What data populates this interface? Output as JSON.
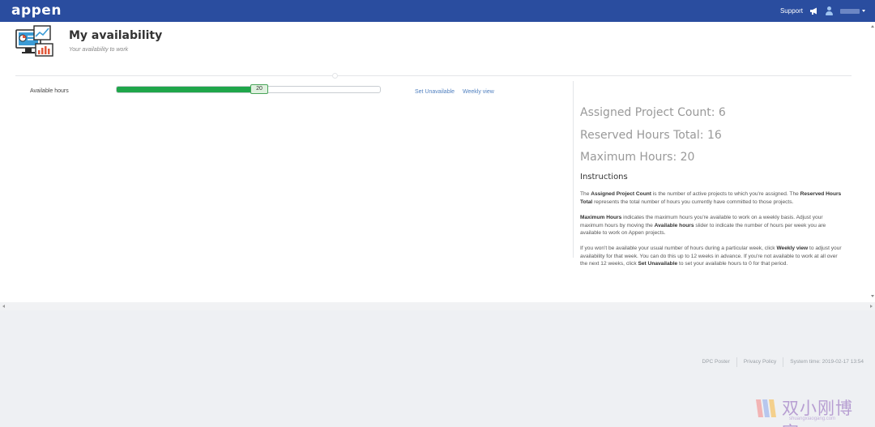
{
  "header": {
    "logo": "appen",
    "support_label": "Support"
  },
  "page": {
    "title": "My availability",
    "subtitle": "Your availability to work"
  },
  "availability": {
    "label": "Available hours",
    "value": "20",
    "fraction": 0.56,
    "set_unavailable_label": "Set Unavailable",
    "weekly_view_label": "Weekly view",
    "fill_color": "#1fa64a"
  },
  "stats": {
    "assigned": "Assigned Project Count: 6",
    "reserved": "Reserved Hours Total: 16",
    "maximum": "Maximum Hours: 20"
  },
  "instructions": {
    "title": "Instructions",
    "p1": [
      {
        "t": "The "
      },
      {
        "b": "Assigned Project Count"
      },
      {
        "t": " is the number of active projects to which you're assigned. The "
      },
      {
        "b": "Reserved Hours Total"
      },
      {
        "t": " represents the total number of hours you currently have committed to those projects."
      }
    ],
    "p2": [
      {
        "b": "Maximum Hours"
      },
      {
        "t": " indicates the maximum hours you're available to work on a weekly basis. Adjust your maximum hours by moving the "
      },
      {
        "b": "Available hours"
      },
      {
        "t": " slider to indicate the number of hours per week you are available to work on Appen projects."
      }
    ],
    "p3": [
      {
        "t": "If you won't be available your usual number of hours during a particular week, click "
      },
      {
        "b": "Weekly view"
      },
      {
        "t": " to adjust your availability for that week. You can do this up to 12 weeks in advance. If you're not available to work at all over the next 12 weeks, click "
      },
      {
        "b": "Set Unavailable"
      },
      {
        "t": " to set your available hours to 0 for that period."
      }
    ]
  },
  "footer": {
    "dpc_poster": "DPC Poster",
    "privacy_policy": "Privacy Policy",
    "system_time": "System time: 2019-02-17 13:54"
  },
  "watermark": {
    "text": "双小刚博客",
    "sub": "shuangxiaogang.com"
  },
  "colors": {
    "nav": "#2a4d9f",
    "link": "#4f7fbf",
    "accent_green": "#1fa64a"
  },
  "icons": [
    "megaphone-icon",
    "user-icon",
    "chevron-down-icon",
    "availability-dashboard-icon"
  ]
}
